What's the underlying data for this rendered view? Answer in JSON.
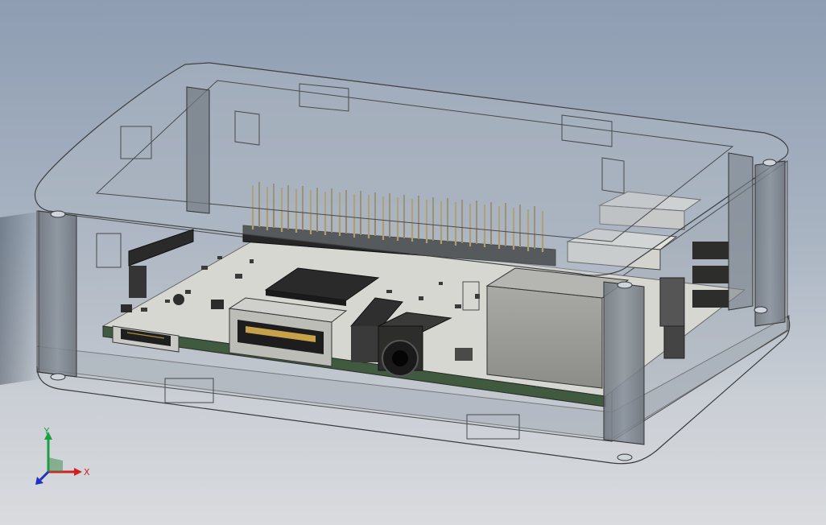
{
  "viewport": {
    "background_top": "#8e9db2",
    "background_bottom": "#d9dbde"
  },
  "model": {
    "case_color": "#9aa3ad",
    "pcb_color": "#d7d7d2",
    "connector_color": "#bdbdb8",
    "pin_color": "#b08a3e"
  },
  "triad": {
    "x_label": "X",
    "y_label": "Y",
    "x_color": "#d02020",
    "y_color": "#1aa040",
    "z_color": "#2030c0"
  }
}
